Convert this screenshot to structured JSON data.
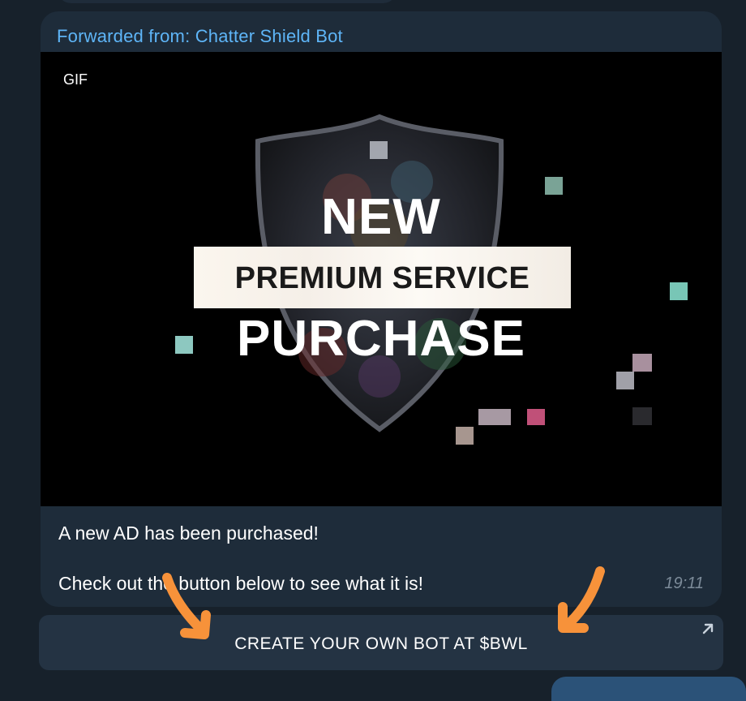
{
  "message": {
    "forwarded_from": "Forwarded from: Chatter Shield Bot",
    "media": {
      "badge": "GIF",
      "line1": "NEW",
      "line2": "PREMIUM SERVICE",
      "line3": "PURCHASE",
      "icon": "shield-logo"
    },
    "caption_line1": "A new AD has been purchased!",
    "caption_line2": "Check out the button below to see what it is!",
    "time": "19:11"
  },
  "inline_button": {
    "label": "CREATE YOUR OWN BOT AT $BWL",
    "icon": "external-link-arrow-icon"
  },
  "annotations": {
    "arrow_color": "#f7923a"
  },
  "colors": {
    "background": "#17212b",
    "bubble": "#1e2c3a",
    "link": "#5eb5f7"
  }
}
